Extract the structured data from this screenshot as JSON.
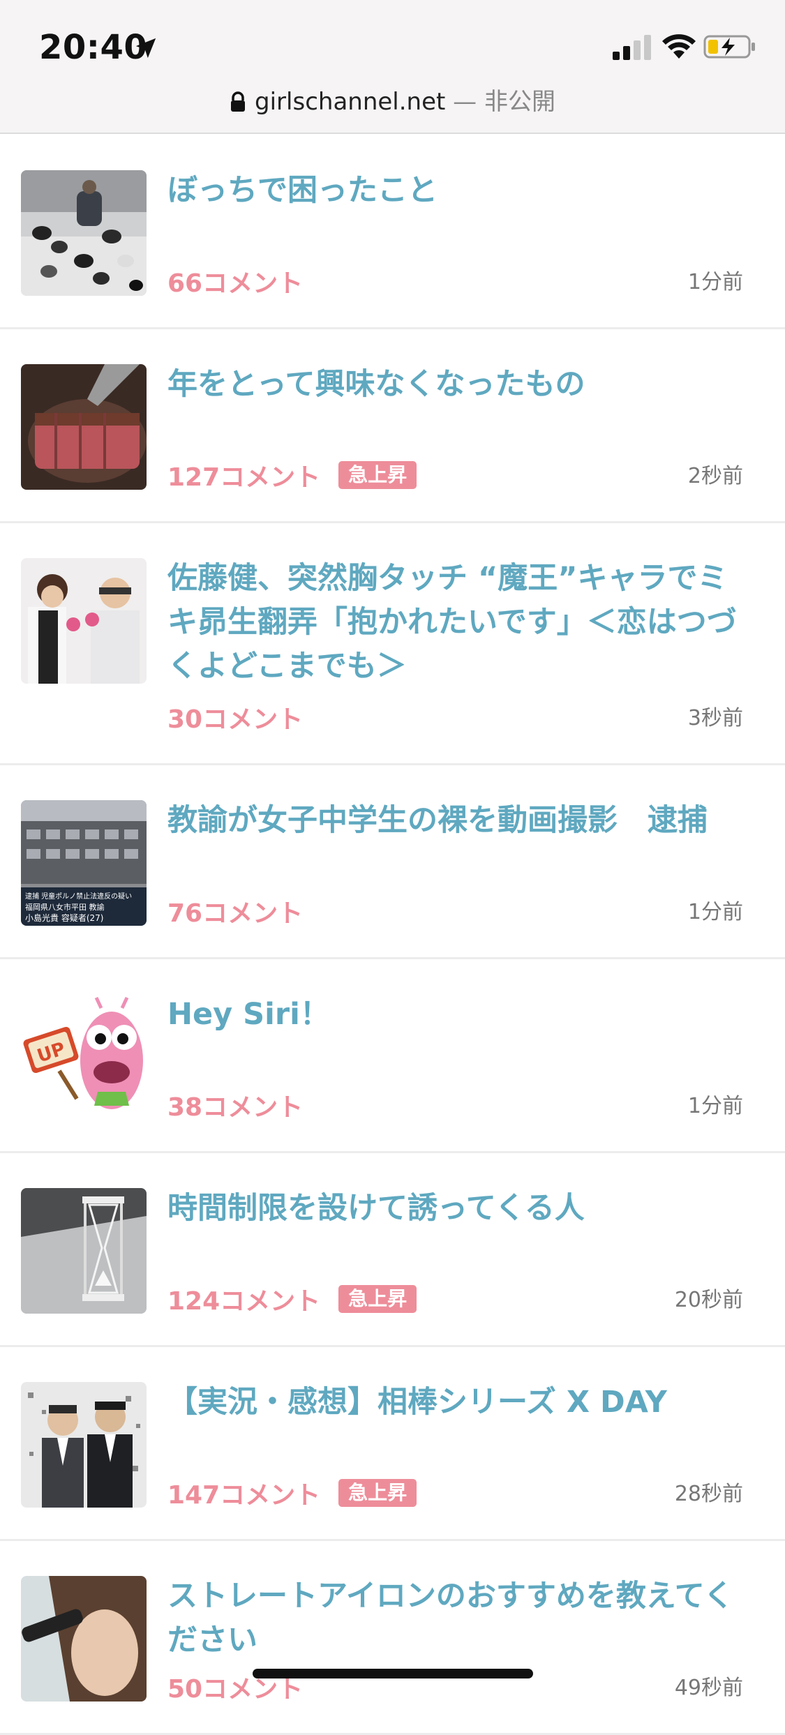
{
  "status_bar": {
    "time": "20:40",
    "location_icon": "location-arrow-icon",
    "signal_icon": "cellular-signal-icon",
    "wifi_icon": "wifi-icon",
    "battery_icon": "battery-charging-icon"
  },
  "url_bar": {
    "domain": "girlschannel.net",
    "separator": " — ",
    "status": "非公開"
  },
  "topics": [
    {
      "title": "ぼっちで困ったこと",
      "comments": "66コメント",
      "badge": "",
      "time": "1分前",
      "thumb": "cats-photo"
    },
    {
      "title": "年をとって興味なくなったもの",
      "comments": "127コメント",
      "badge": "急上昇",
      "time": "2秒前",
      "thumb": "steak-photo"
    },
    {
      "title": "佐藤健、突然胸タッチ “魔王”キャラでミキ昴生翻弄「抱かれたいです」＜恋はつづくよどこまでも＞",
      "comments": "30コメント",
      "badge": "",
      "time": "3秒前",
      "thumb": "tv-show-photo"
    },
    {
      "title": "教諭が女子中学生の裸を動画撮影　逮捕",
      "comments": "76コメント",
      "badge": "",
      "time": "1分前",
      "thumb": "school-news-photo"
    },
    {
      "title": "Hey Siri！",
      "comments": "38コメント",
      "badge": "",
      "time": "1分前",
      "thumb": "up-mascot"
    },
    {
      "title": "時間制限を設けて誘ってくる人",
      "comments": "124コメント",
      "badge": "急上昇",
      "time": "20秒前",
      "thumb": "hourglass-photo"
    },
    {
      "title": "【実況・感想】相棒シリーズ X DAY",
      "comments": "147コメント",
      "badge": "急上昇",
      "time": "28秒前",
      "thumb": "drama-photo"
    },
    {
      "title": "ストレートアイロンのおすすめを教えてください",
      "comments": "50コメント",
      "badge": "",
      "time": "49秒前",
      "thumb": "hair-iron-photo"
    }
  ],
  "thumb_captions": {
    "school_caption_line1": "逮捕 児童ポルノ禁止法違反の疑い",
    "school_caption_line2": "福岡県八女市平田 教諭",
    "school_caption_line3": "小島光貴 容疑者(27)",
    "mascot_sign": "UP"
  },
  "colors": {
    "title": "#5fa8c0",
    "comments": "#ee8d9a",
    "badge_bg": "#ee8d9a",
    "divider": "#ececec"
  }
}
